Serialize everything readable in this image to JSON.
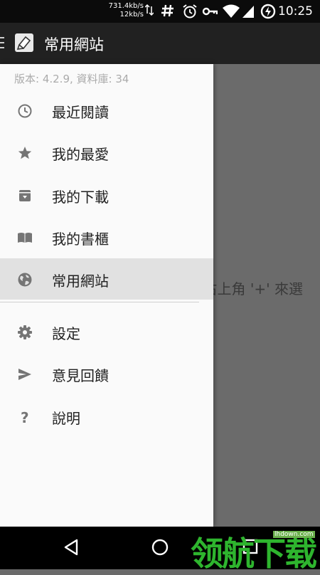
{
  "status_bar": {
    "net_up": "731.4kb/s",
    "net_down": "12kb/s",
    "icons": [
      "data-transfer-icon",
      "hash-icon",
      "alarm-icon",
      "key-icon",
      "wifi-icon",
      "signal-icon",
      "battery-charging-icon"
    ],
    "time": "10:25"
  },
  "appbar": {
    "title": "常用網站",
    "icons": [
      "hamburger-icon",
      "app-logo-icon"
    ]
  },
  "drawer": {
    "version": "版本: 4.2.9, 資料庫: 34",
    "items": [
      {
        "label": "最近閱讀",
        "icon": "clock-icon"
      },
      {
        "label": "我的最愛",
        "icon": "star-icon"
      },
      {
        "label": "我的下載",
        "icon": "download-box-icon"
      },
      {
        "label": "我的書櫃",
        "icon": "book-icon"
      },
      {
        "label": "常用網站",
        "icon": "globe-icon",
        "active": true
      }
    ],
    "secondary_items": [
      {
        "label": "設定",
        "icon": "gear-icon"
      },
      {
        "label": "意見回饋",
        "icon": "send-icon"
      },
      {
        "label": "說明",
        "icon": "help-icon"
      }
    ]
  },
  "main": {
    "hint_text": "右上角 '+' 來選"
  },
  "navbar": {
    "icons": [
      "back-icon",
      "home-icon",
      "recents-icon"
    ]
  },
  "watermark": {
    "text_cn": "领航下载",
    "text_en": "lhdown.com"
  },
  "colors": {
    "status_bar": "#0b0b0b",
    "app_bar": "#212121",
    "drawer_bg": "#fafafa",
    "active_item": "#e1e1e1",
    "icon_gray": "#757575",
    "watermark_green": "#2eb52e"
  }
}
